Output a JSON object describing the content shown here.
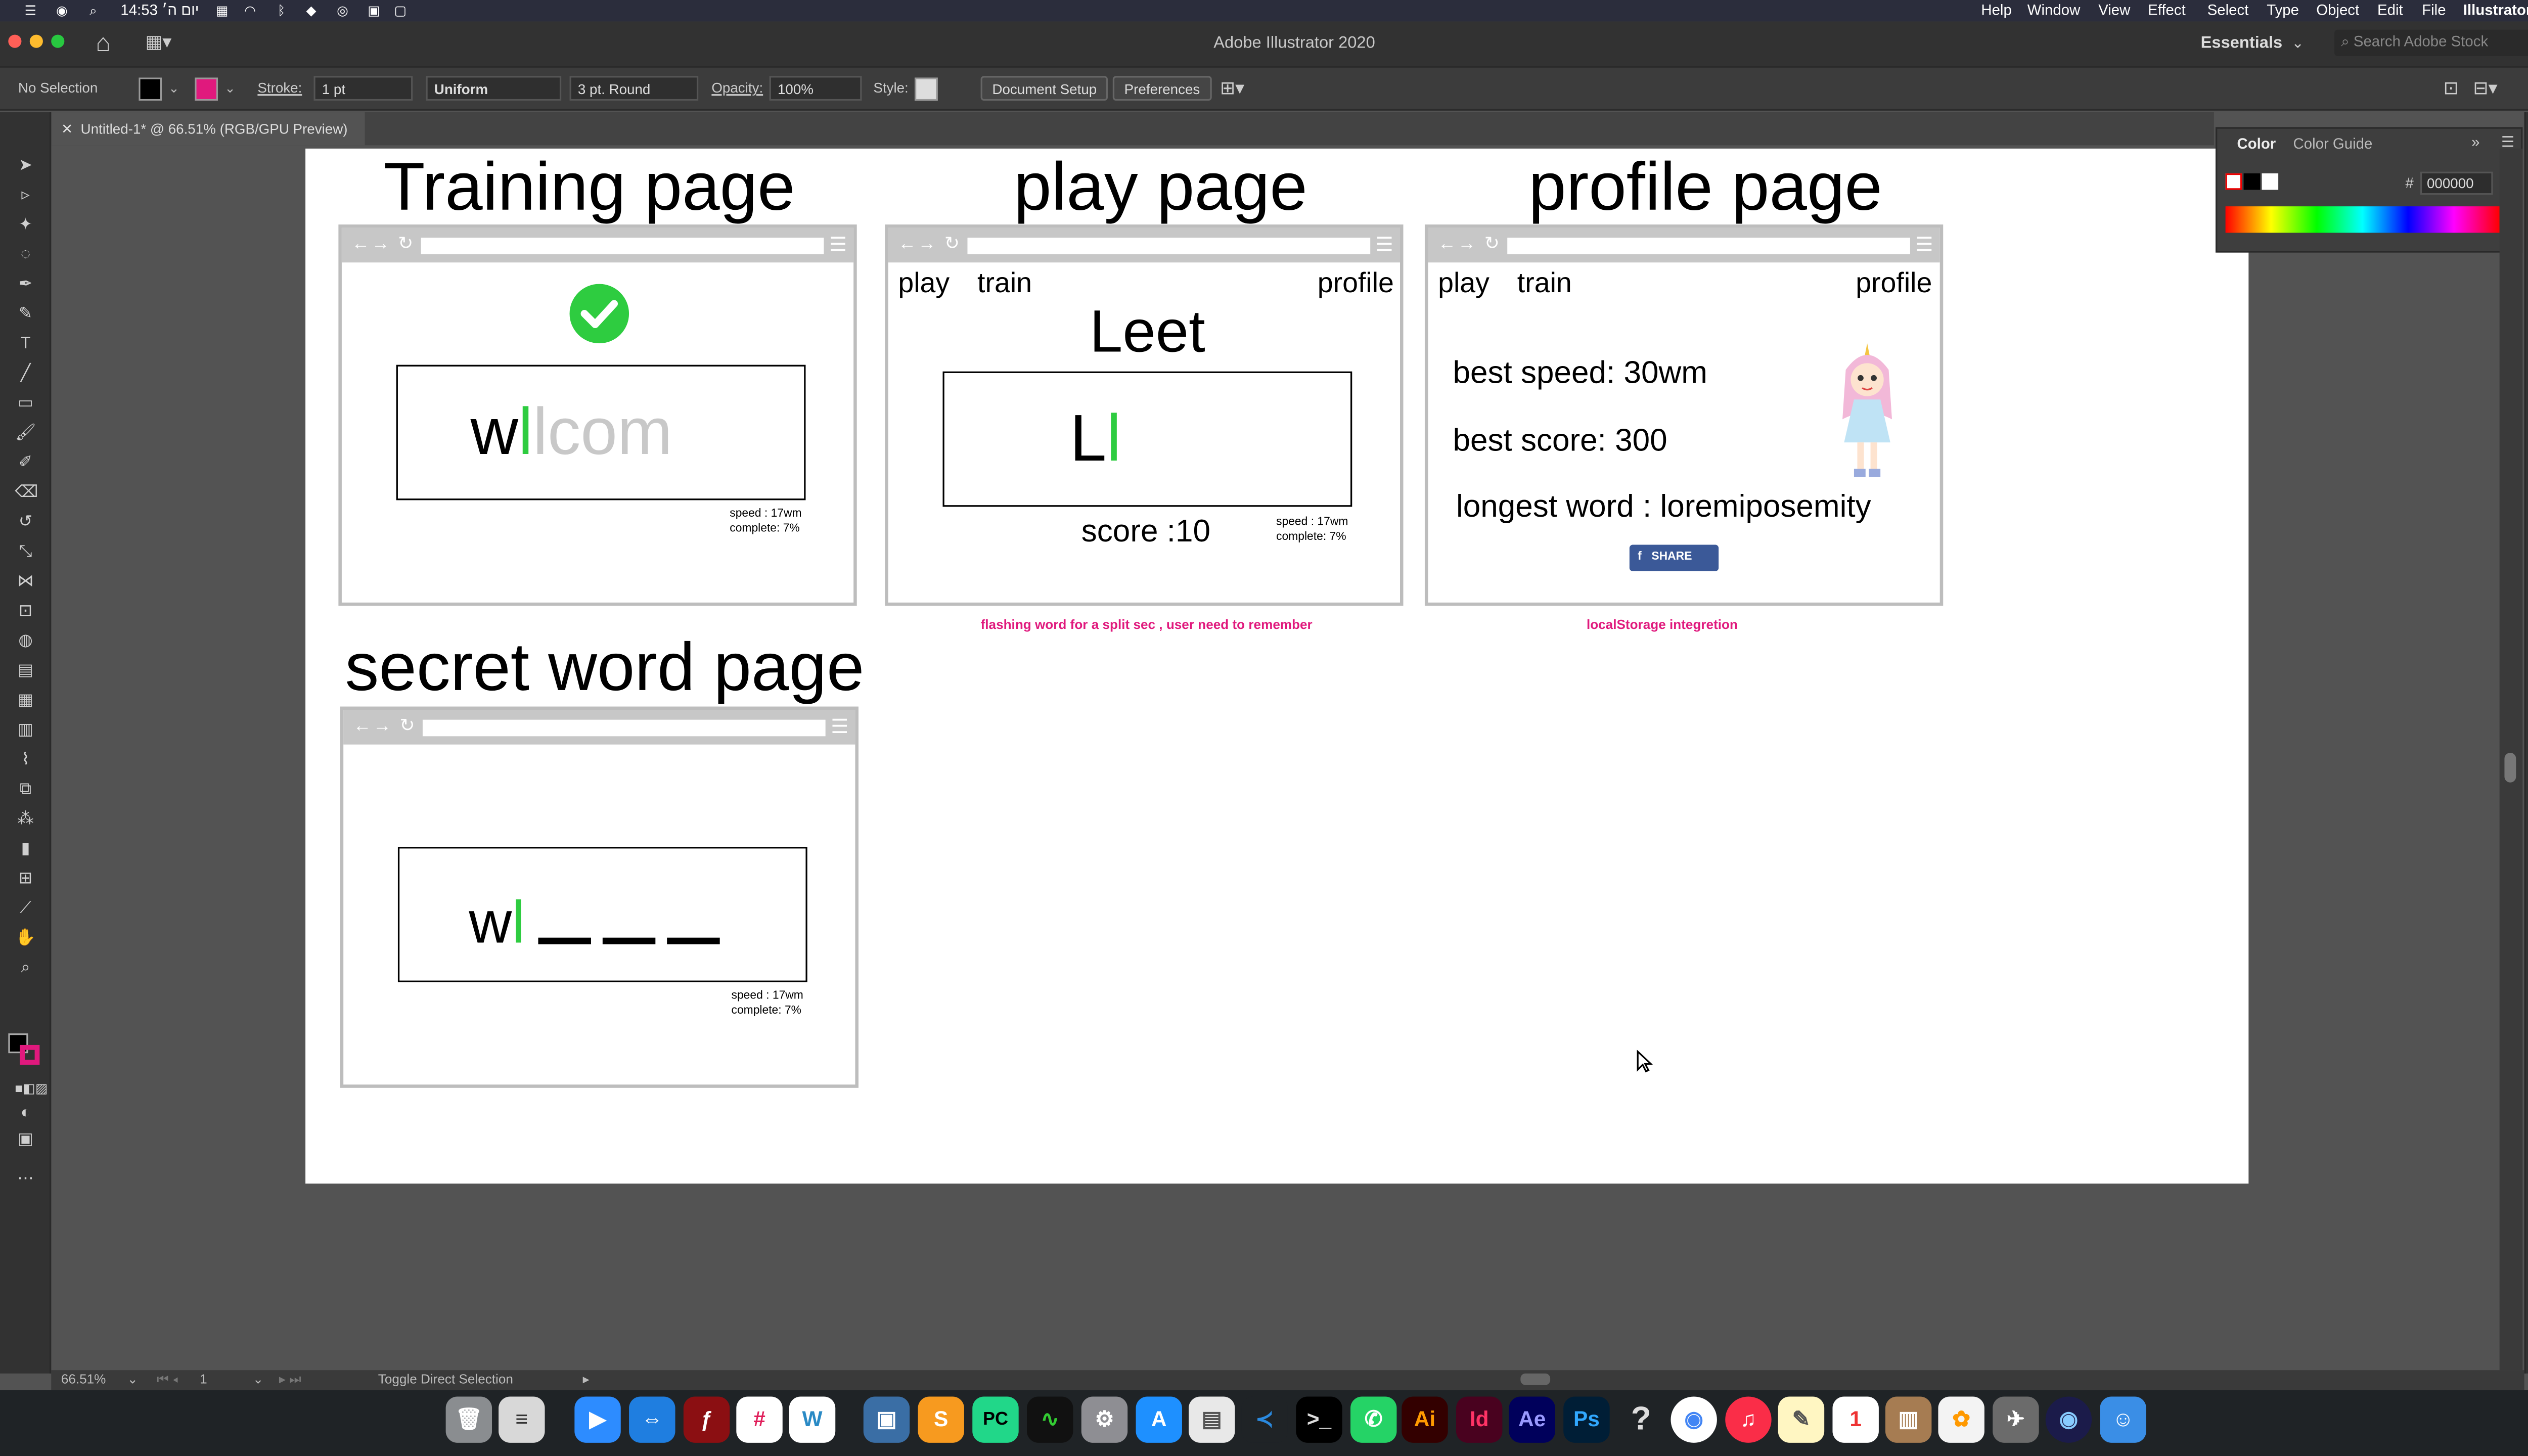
{
  "menubar": {
    "clock": "14:53 יום ה׳",
    "items_right": [
      "Illustrator",
      "File",
      "Edit",
      "Object",
      "Type",
      "Select",
      "Effect",
      "View",
      "Window",
      "Help"
    ]
  },
  "window": {
    "title": "Adobe Illustrator 2020",
    "workspace": "Essentials",
    "search_placeholder": "Search Adobe Stock"
  },
  "controlbar": {
    "selection": "No Selection",
    "stroke_label": "Stroke:",
    "stroke_value": "1 pt",
    "profile": "Uniform",
    "brush": "3 pt. Round",
    "opacity_label": "Opacity:",
    "opacity_value": "100%",
    "style_label": "Style:",
    "doc_setup": "Document Setup",
    "preferences": "Preferences"
  },
  "doc_tab": "Untitled-1* @ 66.51% (RGB/GPU Preview)",
  "color_panel": {
    "tab1": "Color",
    "tab2": "Color Guide",
    "hex_symbol": "#",
    "hex": "000000"
  },
  "artboard": {
    "training": {
      "title": "Training page",
      "typed": "w",
      "cursor": "l",
      "rest": "lcom",
      "speed": "speed : 17wm",
      "complete": "complete: 7%"
    },
    "play": {
      "title": "play page",
      "nav_play": "play",
      "nav_train": "train",
      "nav_profile": "profile",
      "flash_word": "Leet",
      "typed": "L",
      "cursor": "l",
      "score": "score :10",
      "speed": "speed : 17wm",
      "complete": "complete: 7%",
      "note": "flashing word for a split sec , user need to remember"
    },
    "profile": {
      "title": "profile page",
      "nav_play": "play",
      "nav_train": "train",
      "nav_profile": "profile",
      "best_speed": "best speed: 30wm",
      "best_score": "best score: 300",
      "longest_word": "longest word : loremiposemity",
      "share": "SHARE",
      "note": "localStorage integretion"
    },
    "secret": {
      "title": "secret word page",
      "typed": "w",
      "cursor": "l",
      "speed": "speed : 17wm",
      "complete": "complete: 7%"
    },
    "browser_nav": "←→ ↻",
    "browser_menu": "☰"
  },
  "statusbar": {
    "zoom": "66.51%",
    "page": "1",
    "tool_hint": "Toggle Direct Selection"
  },
  "dock_icons": [
    "trash-icon",
    "notes-icon",
    "zoom-icon",
    "teamviewer-icon",
    "flash-icon",
    "slack-icon",
    "webstorm-icon",
    "virtualbox-icon",
    "sublime-icon",
    "pycharm-icon",
    "activity-icon",
    "settings-icon",
    "appstore-icon",
    "preview-icon",
    "vscode-icon",
    "terminal-icon",
    "whatsapp-icon",
    "illustrator-icon",
    "indesign-icon",
    "aftereffects-icon",
    "photoshop-icon",
    "help-icon",
    "chrome-icon",
    "music-icon",
    "notes2-icon",
    "calendar-icon",
    "archive-icon",
    "photos-icon",
    "launchpad-icon",
    "siri-icon",
    "finder-icon"
  ],
  "dock_labels": {
    "ai": "Ai",
    "id": "Id",
    "ae": "Ae",
    "ps": "Ps",
    "pc": "PC",
    "w": "W",
    "help": "?"
  },
  "colors": {
    "accent_green": "#2ecc40",
    "note_pink": "#e0197d",
    "fb_blue": "#3b5998",
    "artboard_bg": "#ffffff",
    "ui_bg": "#535353"
  }
}
